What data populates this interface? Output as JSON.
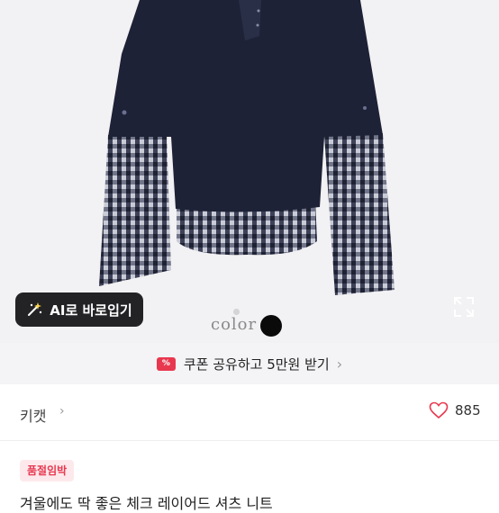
{
  "hero": {
    "ai_button_label": "AI로 바로입기",
    "color_label": "color",
    "swatch_color": "#0a0a0a"
  },
  "coupon": {
    "label": "쿠폰 공유하고 5만원 받기",
    "icon_text": "%"
  },
  "shop": {
    "name": "키캣",
    "like_count": "885"
  },
  "product": {
    "badge": "품절임박",
    "title_peek": "겨울에도 딱 좋은 체크 레이어드 셔츠 니트"
  },
  "colors": {
    "accent": "#e8384f",
    "navy": "#1e2237"
  }
}
